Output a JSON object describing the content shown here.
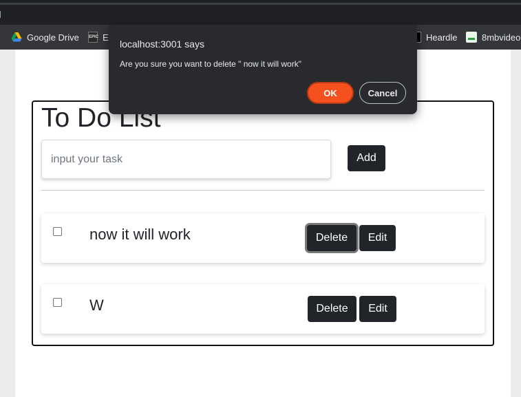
{
  "bookmarks": [
    {
      "label": "Google Drive",
      "icon": "google-drive-icon"
    },
    {
      "label": "Ep",
      "icon": "epic-games-icon",
      "icon_text": "EPIC"
    },
    {
      "label": "Heardle",
      "icon": "heardle-icon"
    },
    {
      "label": "8mbvideo",
      "icon": "8mbvideo-icon"
    }
  ],
  "dialog": {
    "title": "localhost:3001 says",
    "message": "Are you sure you want to delete \" now it will work\"",
    "ok_label": "OK",
    "cancel_label": "Cancel",
    "ok_color": "#f4511e"
  },
  "todo": {
    "title": "To Do List",
    "input_placeholder": "input your task",
    "add_label": "Add",
    "items": [
      {
        "text": "now it will work",
        "checked": false,
        "delete_label": "Delete",
        "edit_label": "Edit"
      },
      {
        "text": "W",
        "checked": false,
        "delete_label": "Delete",
        "edit_label": "Edit"
      }
    ]
  },
  "colors": {
    "button_dark": "#212529",
    "chrome_dark": "#202124",
    "bookmarks_bar": "#35363a"
  }
}
